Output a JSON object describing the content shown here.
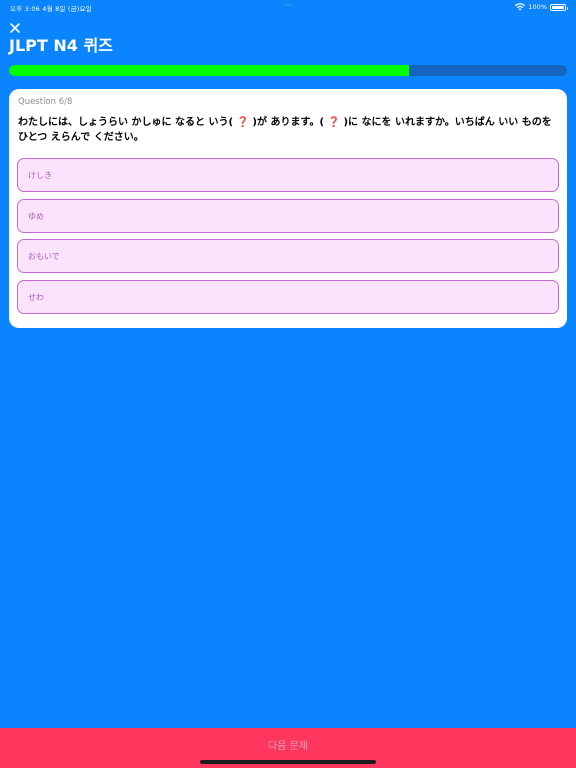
{
  "status_bar": {
    "time_date": "오후 3:06  4월 8일 (금)요일",
    "center_dots": "···",
    "battery": "100%"
  },
  "header": {
    "close_icon": "close-icon",
    "title": "JLPT N4 퀴즈"
  },
  "progress": {
    "current": 6,
    "total": 8,
    "fraction": 0.716,
    "fill_color": "#00ff00",
    "track_color": "#1565c0"
  },
  "question": {
    "number_label": "Question 6/8",
    "text": "わたしには、しょうらい かしゅに なると いう( ❓ )が あります。( ❓ )に なにを いれますか。いちばん いい ものを ひとつ えらんで ください。"
  },
  "options": [
    {
      "label": "けしき"
    },
    {
      "label": "ゆめ"
    },
    {
      "label": "おもいで"
    },
    {
      "label": "せわ"
    }
  ],
  "footer": {
    "next_label": "다음 문제",
    "button_color": "#ff375f"
  },
  "colors": {
    "background": "#0a84ff",
    "option_bg": "#fbe3fb",
    "option_border": "#c36ad6"
  }
}
